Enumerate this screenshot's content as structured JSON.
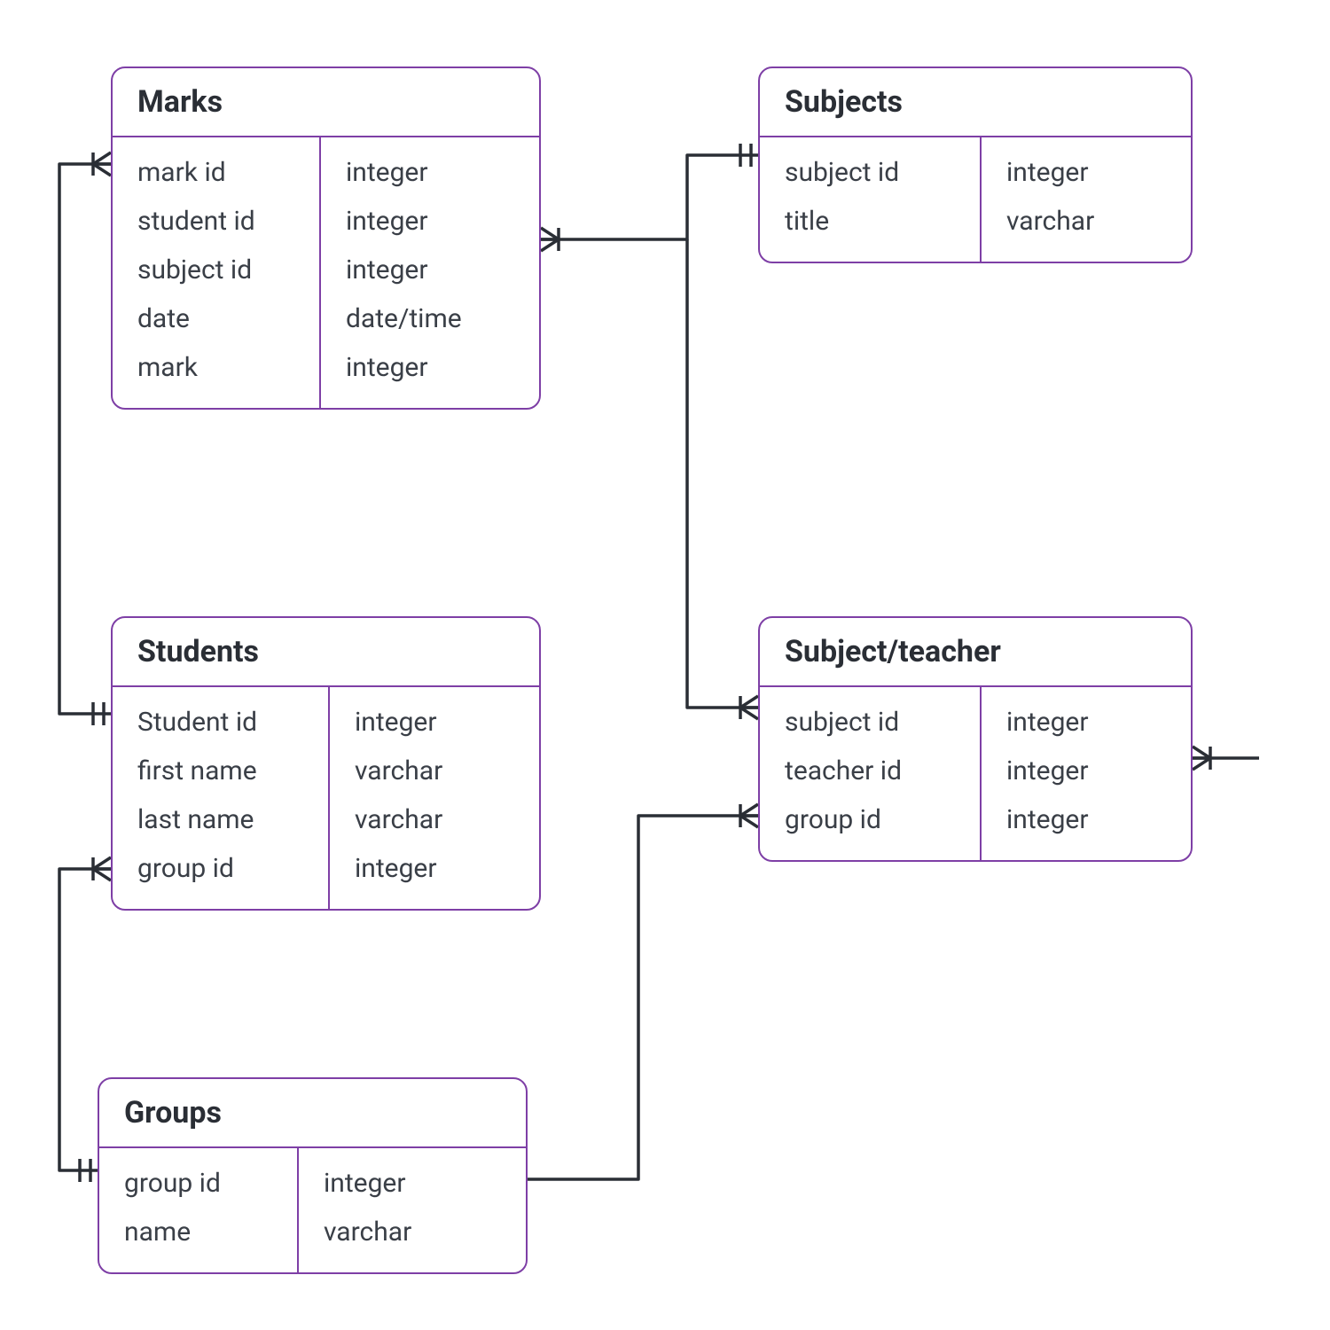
{
  "colors": {
    "entity_border": "#7e3fa6",
    "text_header": "#2a2e35",
    "text_body": "#3a3f47",
    "connector": "#2a2e35",
    "background": "#ffffff"
  },
  "entities": {
    "marks": {
      "title": "Marks",
      "fields": [
        {
          "name": "mark id",
          "type": "integer"
        },
        {
          "name": "student id",
          "type": "integer"
        },
        {
          "name": "subject id",
          "type": "integer"
        },
        {
          "name": "date",
          "type": "date/time"
        },
        {
          "name": "mark",
          "type": "integer"
        }
      ]
    },
    "subjects": {
      "title": "Subjects",
      "fields": [
        {
          "name": "subject id",
          "type": "integer"
        },
        {
          "name": "title",
          "type": "varchar"
        }
      ]
    },
    "students": {
      "title": "Students",
      "fields": [
        {
          "name": "Student id",
          "type": "integer"
        },
        {
          "name": "first name",
          "type": "varchar"
        },
        {
          "name": "last name",
          "type": "varchar"
        },
        {
          "name": "group id",
          "type": "integer"
        }
      ]
    },
    "subject_teacher": {
      "title": "Subject/teacher",
      "fields": [
        {
          "name": "subject id",
          "type": "integer"
        },
        {
          "name": "teacher id",
          "type": "integer"
        },
        {
          "name": "group id",
          "type": "integer"
        }
      ]
    },
    "groups": {
      "title": "Groups",
      "fields": [
        {
          "name": "group id",
          "type": "integer"
        },
        {
          "name": "name",
          "type": "varchar"
        }
      ]
    }
  },
  "relationships": [
    {
      "from": "students",
      "to": "marks",
      "type": "one-to-many"
    },
    {
      "from": "subjects",
      "to": "marks",
      "type": "one-to-many"
    },
    {
      "from": "subjects",
      "to": "subject_teacher",
      "type": "one-to-many"
    },
    {
      "from": "groups",
      "to": "students",
      "type": "one-to-many"
    },
    {
      "from": "groups",
      "to": "subject_teacher",
      "type": "one-to-many"
    },
    {
      "from": "teachers_external",
      "to": "subject_teacher",
      "type": "one-to-many"
    }
  ]
}
